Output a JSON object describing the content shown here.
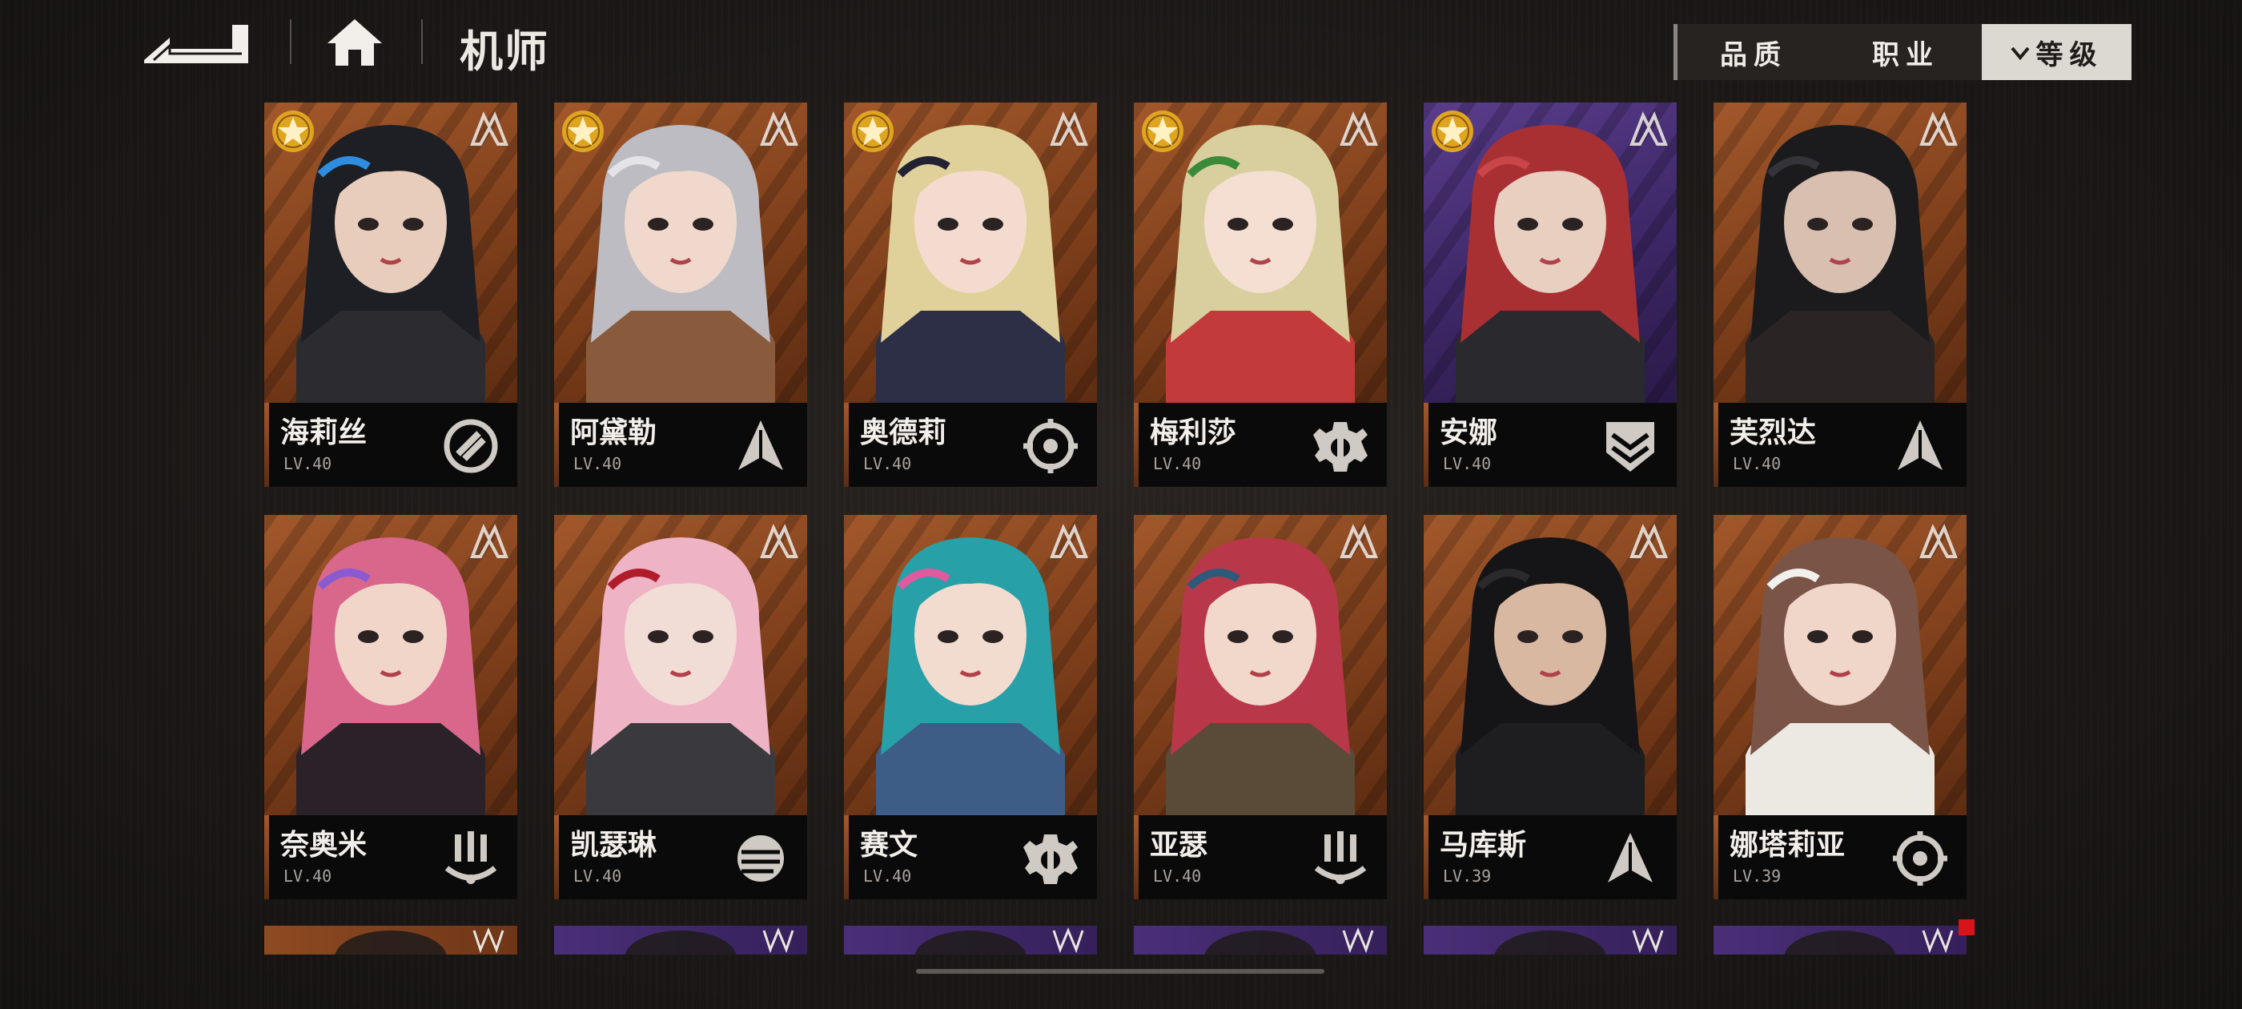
{
  "header": {
    "back_icon": "back-arrow-icon",
    "home_icon": "home-icon",
    "title": "机师"
  },
  "filters": {
    "quality": "品质",
    "profession": "职业",
    "level": "等级",
    "level_chevron": "chevron-down-icon"
  },
  "pilots": [
    {
      "name": "海莉丝",
      "level": "LV.40",
      "bg": "orange",
      "star": true,
      "class_icon": "fist-icon",
      "hair": "#1d1f24",
      "accent": "#2f8de0",
      "skin": "#e9cdbc",
      "outfit": "#2c2c30"
    },
    {
      "name": "阿黛勒",
      "level": "LV.40",
      "bg": "orange",
      "star": true,
      "class_icon": "spearhead-icon",
      "hair": "#bcbcc2",
      "accent": "#e3e3e8",
      "skin": "#f0d9cc",
      "outfit": "#8a5a3c"
    },
    {
      "name": "奥德莉",
      "level": "LV.40",
      "bg": "orange",
      "star": true,
      "class_icon": "crosshair-icon",
      "hair": "#e0d19a",
      "accent": "#222232",
      "skin": "#f3dccf",
      "outfit": "#2c2f45"
    },
    {
      "name": "梅利莎",
      "level": "LV.40",
      "bg": "orange",
      "star": true,
      "class_icon": "wrench-gear-icon",
      "hair": "#d9cf9e",
      "accent": "#3b8a3a",
      "skin": "#f4dfd2",
      "outfit": "#c23a3a"
    },
    {
      "name": "安娜",
      "level": "LV.40",
      "bg": "purple",
      "star": true,
      "class_icon": "shield-chevron-icon",
      "hair": "#a83032",
      "accent": "#c94548",
      "skin": "#e8cfc0",
      "outfit": "#2a2a2e"
    },
    {
      "name": "芙烈达",
      "level": "LV.40",
      "bg": "orange",
      "star": false,
      "class_icon": "spearhead-icon",
      "hair": "#1b1b1e",
      "accent": "#333338",
      "skin": "#d9bfb0",
      "outfit": "#2a2524"
    },
    {
      "name": "奈奥米",
      "level": "LV.40",
      "bg": "orange",
      "star": false,
      "class_icon": "missiles-icon",
      "hair": "#d9678c",
      "accent": "#8a5ad0",
      "skin": "#f1d5c8",
      "outfit": "#2a2228"
    },
    {
      "name": "凯瑟琳",
      "level": "LV.40",
      "bg": "orange",
      "star": false,
      "class_icon": "drum-icon",
      "hair": "#eeb3c4",
      "accent": "#b01c2a",
      "skin": "#f2ddd6",
      "outfit": "#3a3a3e"
    },
    {
      "name": "赛文",
      "level": "LV.40",
      "bg": "orange",
      "star": false,
      "class_icon": "wrench-gear-icon",
      "hair": "#28a0a8",
      "accent": "#e05aa0",
      "skin": "#f2dcd0",
      "outfit": "#3d5d86"
    },
    {
      "name": "亚瑟",
      "level": "LV.40",
      "bg": "orange",
      "star": false,
      "class_icon": "missiles-icon",
      "hair": "#b8384a",
      "accent": "#2c5a78",
      "skin": "#f1d8cb",
      "outfit": "#5a4a38"
    },
    {
      "name": "马库斯",
      "level": "LV.39",
      "bg": "orange",
      "star": false,
      "class_icon": "spearhead-icon",
      "hair": "#151517",
      "accent": "#2a2a2c",
      "skin": "#d9b8a2",
      "outfit": "#1e1e20"
    },
    {
      "name": "娜塔莉亚",
      "level": "LV.39",
      "bg": "orange",
      "star": false,
      "class_icon": "crosshair-icon",
      "hair": "#7a5446",
      "accent": "#f2f0ec",
      "skin": "#f0d6c8",
      "outfit": "#ece8e2"
    }
  ],
  "peek_row": [
    "orange",
    "purple",
    "purple",
    "purple",
    "purple",
    "purple"
  ]
}
